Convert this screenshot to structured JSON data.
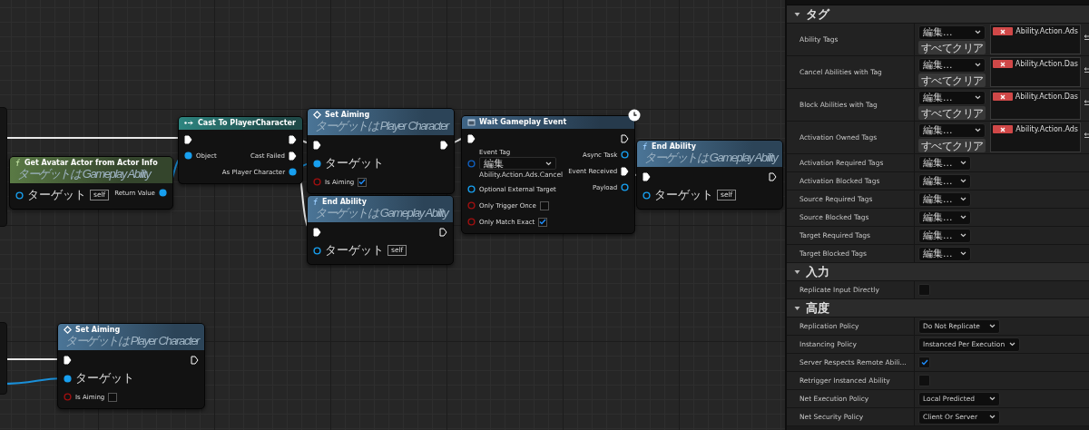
{
  "graph": {
    "nodes": [
      {
        "kind": "pure",
        "title": "Get Avatar Actor from Actor Info",
        "subtitle": "ターゲットは Gameplay Ability",
        "inputs": [
          {
            "kind": "object",
            "label": "ターゲット",
            "value": "self",
            "connected": false
          }
        ],
        "outputs": [
          {
            "kind": "object",
            "label": "Return Value",
            "connected": true
          }
        ]
      },
      {
        "kind": "cast",
        "title": "Cast To PlayerCharacter",
        "inputs": [
          {
            "kind": "exec",
            "connected": true
          },
          {
            "kind": "object",
            "label": "Object",
            "connected": true
          }
        ],
        "outputs": [
          {
            "kind": "exec",
            "connected": true
          },
          {
            "kind": "exec",
            "label": "Cast Failed",
            "connected": true
          },
          {
            "kind": "object",
            "label": "As Player Character",
            "connected": true
          }
        ]
      },
      {
        "kind": "setter",
        "title": "Set Aiming",
        "subtitle": "ターゲットは Player Character",
        "inputs": [
          {
            "kind": "exec",
            "connected": true
          },
          {
            "kind": "object",
            "label": "ターゲット",
            "connected": true
          },
          {
            "kind": "bool",
            "label": "Is Aiming",
            "checked": true
          }
        ],
        "outputs": [
          {
            "kind": "exec",
            "connected": true
          }
        ]
      },
      {
        "kind": "function",
        "title": "End Ability",
        "subtitle": "ターゲットは Gameplay Ability",
        "inputs": [
          {
            "kind": "exec",
            "connected": true
          },
          {
            "kind": "object",
            "label": "ターゲット",
            "value": "self",
            "connected": false
          }
        ],
        "outputs": [
          {
            "kind": "exec",
            "connected": false
          }
        ]
      },
      {
        "kind": "async",
        "title": "Wait Gameplay Event",
        "inputs": [
          {
            "kind": "exec",
            "connected": true
          },
          {
            "kind": "tag",
            "label": "Event Tag",
            "value": "編集",
            "tag": "Ability.Action.Ads.Cancel"
          },
          {
            "kind": "object",
            "label": "Optional External Target",
            "connected": false
          },
          {
            "kind": "bool",
            "label": "Only Trigger Once",
            "checked": false
          },
          {
            "kind": "bool",
            "label": "Only Match Exact",
            "checked": true
          }
        ],
        "outputs": [
          {
            "kind": "exec",
            "connected": false
          },
          {
            "kind": "object",
            "label": "Async Task",
            "connected": false
          },
          {
            "kind": "exec",
            "label": "Event Received",
            "connected": true
          },
          {
            "kind": "object",
            "label": "Payload",
            "connected": false
          }
        ]
      },
      {
        "kind": "function",
        "title": "End Ability",
        "subtitle": "ターゲットは Gameplay Ability",
        "inputs": [
          {
            "kind": "exec",
            "connected": true
          },
          {
            "kind": "object",
            "label": "ターゲット",
            "value": "self",
            "connected": false
          }
        ],
        "outputs": [
          {
            "kind": "exec",
            "connected": false
          }
        ]
      },
      {
        "kind": "setter",
        "title": "Set Aiming",
        "subtitle": "ターゲットは Player Character",
        "inputs": [
          {
            "kind": "exec",
            "connected": true
          },
          {
            "kind": "object",
            "label": "ターゲット",
            "connected": true
          },
          {
            "kind": "bool",
            "label": "Is Aiming",
            "checked": false
          }
        ],
        "outputs": [
          {
            "kind": "exec",
            "connected": false
          }
        ]
      }
    ]
  },
  "details": {
    "sections": [
      {
        "title": "タグ",
        "expanded": true,
        "rows": [
          {
            "kind": "tags",
            "label": "Ability Tags",
            "button": "編集...",
            "clear": "すべてクリア",
            "tags": [
              "Ability.Action.Ads"
            ]
          },
          {
            "kind": "tags",
            "label": "Cancel Abilities with Tag",
            "button": "編集...",
            "clear": "すべてクリア",
            "tags": [
              "Ability.Action.Das"
            ]
          },
          {
            "kind": "tags",
            "label": "Block Abilities with Tag",
            "button": "編集...",
            "clear": "すべてクリア",
            "tags": [
              "Ability.Action.Das"
            ]
          },
          {
            "kind": "tags",
            "label": "Activation Owned Tags",
            "button": "編集...",
            "clear": "すべてクリア",
            "tags": [
              "Ability.Action.Ads"
            ]
          },
          {
            "kind": "tag_edit",
            "label": "Activation Required Tags",
            "button": "編集..."
          },
          {
            "kind": "tag_edit",
            "label": "Activation Blocked Tags",
            "button": "編集..."
          },
          {
            "kind": "tag_edit",
            "label": "Source Required Tags",
            "button": "編集..."
          },
          {
            "kind": "tag_edit",
            "label": "Source Blocked Tags",
            "button": "編集..."
          },
          {
            "kind": "tag_edit",
            "label": "Target Required Tags",
            "button": "編集..."
          },
          {
            "kind": "tag_edit",
            "label": "Target Blocked Tags",
            "button": "編集..."
          }
        ]
      },
      {
        "title": "入力",
        "expanded": true,
        "rows": [
          {
            "kind": "checkbox",
            "label": "Replicate Input Directly",
            "checked": false
          }
        ]
      },
      {
        "title": "高度",
        "expanded": true,
        "rows": [
          {
            "kind": "dropdown",
            "label": "Replication Policy",
            "value": "Do Not Replicate"
          },
          {
            "kind": "dropdown",
            "label": "Instancing Policy",
            "value": "Instanced Per Execution"
          },
          {
            "kind": "checkbox",
            "label": "Server Respects Remote Abili...",
            "checked": true
          },
          {
            "kind": "checkbox",
            "label": "Retrigger Instanced Ability",
            "checked": false
          },
          {
            "kind": "dropdown",
            "label": "Net Execution Policy",
            "value": "Local Predicted"
          },
          {
            "kind": "dropdown",
            "label": "Net Security Policy",
            "value": "Client Or Server"
          }
        ]
      }
    ]
  }
}
